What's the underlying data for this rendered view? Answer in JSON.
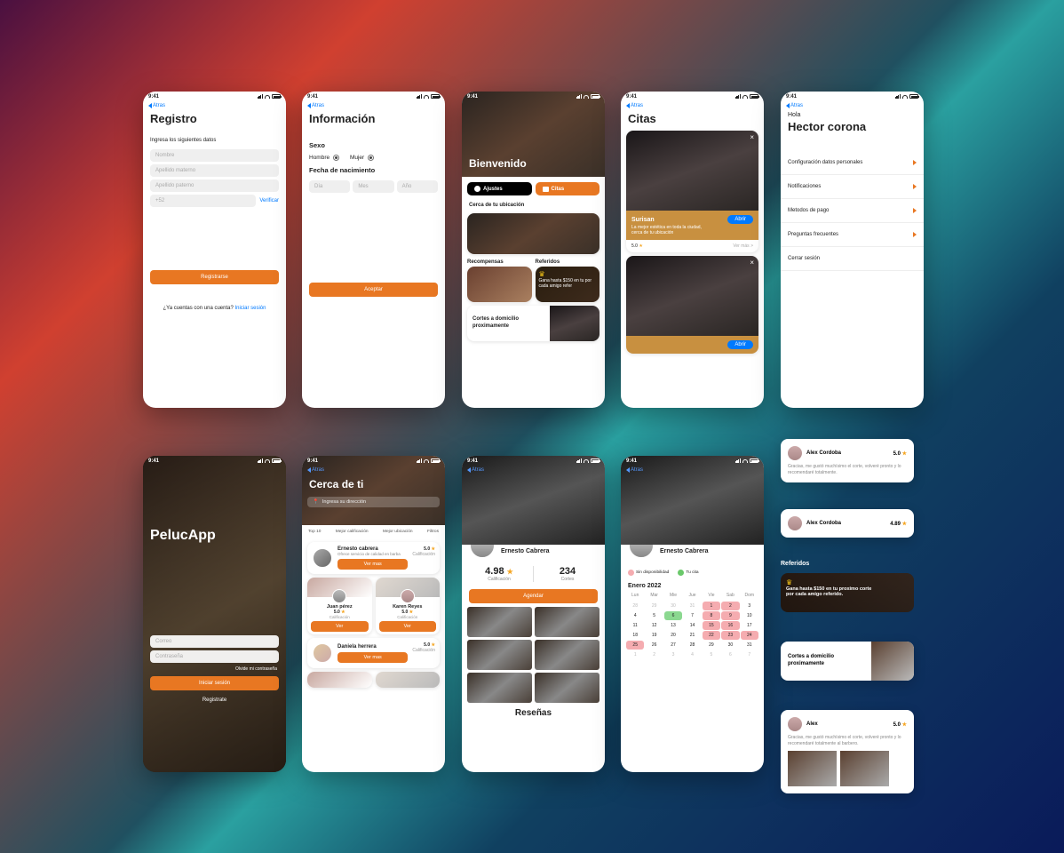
{
  "status": {
    "time": "9:41"
  },
  "nav": {
    "back": "Atras"
  },
  "common": {
    "star": "★"
  },
  "app_name": "PelucApp",
  "registro": {
    "title": "Registro",
    "subtitle": "Ingresa los siguientes datos",
    "ph_nombre": "Nombre",
    "ph_materno": "Apellido materno",
    "ph_paterno": "Apellido paterno",
    "ph_phone": "+52",
    "verify": "Verificar",
    "submit": "Registrarse",
    "have_account": "¿Ya cuentas con una cuenta?",
    "login_link": "Iniciar sesión"
  },
  "informacion": {
    "title": "Información",
    "sexo_label": "Sexo",
    "hombre": "Hombre",
    "mujer": "Mujer",
    "dob_label": "Fecha de nacimiento",
    "ph_dia": "Día",
    "ph_mes": "Mes",
    "ph_ano": "Año",
    "accept": "Aceptar"
  },
  "bienvenido": {
    "title": "Bienvenido",
    "btn_ajustes": "Ajustes",
    "btn_citas": "Citas",
    "sec_cerca": "Cerca de tu ubicación",
    "sec_recompensas": "Recompensas",
    "sec_referidos": "Referidos",
    "ref_text": "Gana hasta $150 en tu por cada amigo refer",
    "home_text": "Cortes a domicilio proximamente"
  },
  "citas": {
    "title": "Citas",
    "card_title": "Surisan",
    "card_sub": "La mejor estética en toda la ciudad, cerca de tu ubicación",
    "card_btn": "Abrir",
    "rating": "5.0",
    "ver_mas": "Ver más >"
  },
  "perfil": {
    "hola": "Hola",
    "name": "Hector corona",
    "items": [
      "Configuración datos personales",
      "Notificaciones",
      "Metodos de pago",
      "Preguntas frecuentes",
      "Cerrar sesión"
    ]
  },
  "login": {
    "ph_correo": "Correo",
    "ph_pass": "Contraseña",
    "forgot": "Olvide mi contraseña",
    "submit": "Iniciar sesión",
    "register": "Registrate"
  },
  "cerca": {
    "title": "Cerca de ti",
    "ph_address": "Ingresa su dirección",
    "filters": [
      "Top 10",
      "Mejor calificación",
      "Mejor ubicación",
      "Filtros"
    ],
    "barber1": {
      "name": "Ernesto cabrera",
      "sub": "Ofrece servicio de calidad en barba",
      "rating": "5.0",
      "label": "Calificación",
      "btn": "Ver mas"
    },
    "barber2": {
      "name": "Juan pérez",
      "rating": "5.0",
      "label": "Calificación",
      "btn": "Ver"
    },
    "barber3": {
      "name": "Karen Reyes",
      "rating": "5.0",
      "label": "Calificación",
      "btn": "Ver"
    },
    "barber4": {
      "name": "Daniela herrera",
      "rating": "5.0",
      "label": "Calificación",
      "btn": "Ver mas"
    }
  },
  "barber_profile": {
    "name": "Ernesto Cabrera",
    "rating": "4.98",
    "rating_label": "Calificación",
    "cuts": "234",
    "cuts_label": "Cortes",
    "book_btn": "Agendar",
    "reviews_title": "Reseñas"
  },
  "calendar": {
    "name": "Ernesto Cabrera",
    "legend_unavail": "Sin disponibilidad",
    "legend_avail": "Tu cita",
    "month": "Enero 2022",
    "days_header": [
      "Lun",
      "Mar",
      "Mie",
      "Jue",
      "Vie",
      "Sab",
      "Dom"
    ],
    "weeks": [
      [
        "28",
        "29",
        "30",
        "31",
        "1",
        "2",
        "3"
      ],
      [
        "4",
        "5",
        "6",
        "7",
        "8",
        "9",
        "10"
      ],
      [
        "11",
        "12",
        "13",
        "14",
        "15",
        "16",
        "17"
      ],
      [
        "18",
        "19",
        "20",
        "21",
        "22",
        "23",
        "24"
      ],
      [
        "25",
        "26",
        "27",
        "28",
        "29",
        "30",
        "31"
      ],
      [
        "1",
        "2",
        "3",
        "4",
        "5",
        "6",
        "7"
      ]
    ]
  },
  "reviews": {
    "r1": {
      "name": "Alex Cordoba",
      "rating": "5.0",
      "text": "Gracias, me gustó muchísimo el corte, volveré pronto y lo recomendaré totalmente."
    },
    "r2": {
      "name": "Alex Cordoba",
      "rating": "4.89"
    },
    "r3": {
      "name": "Alex",
      "rating": "5.0",
      "text": "Gracias, me gustó muchísimo el corte, volveré pronto y lo recomendaré totalmente al barbero."
    }
  },
  "ref_section": {
    "header": "Referidos",
    "line1": "Gana hasta $150 en tu proximo corte",
    "line2": "por cada amigo referido."
  },
  "home_section": {
    "text": "Cortes a domicilio proximamente"
  }
}
